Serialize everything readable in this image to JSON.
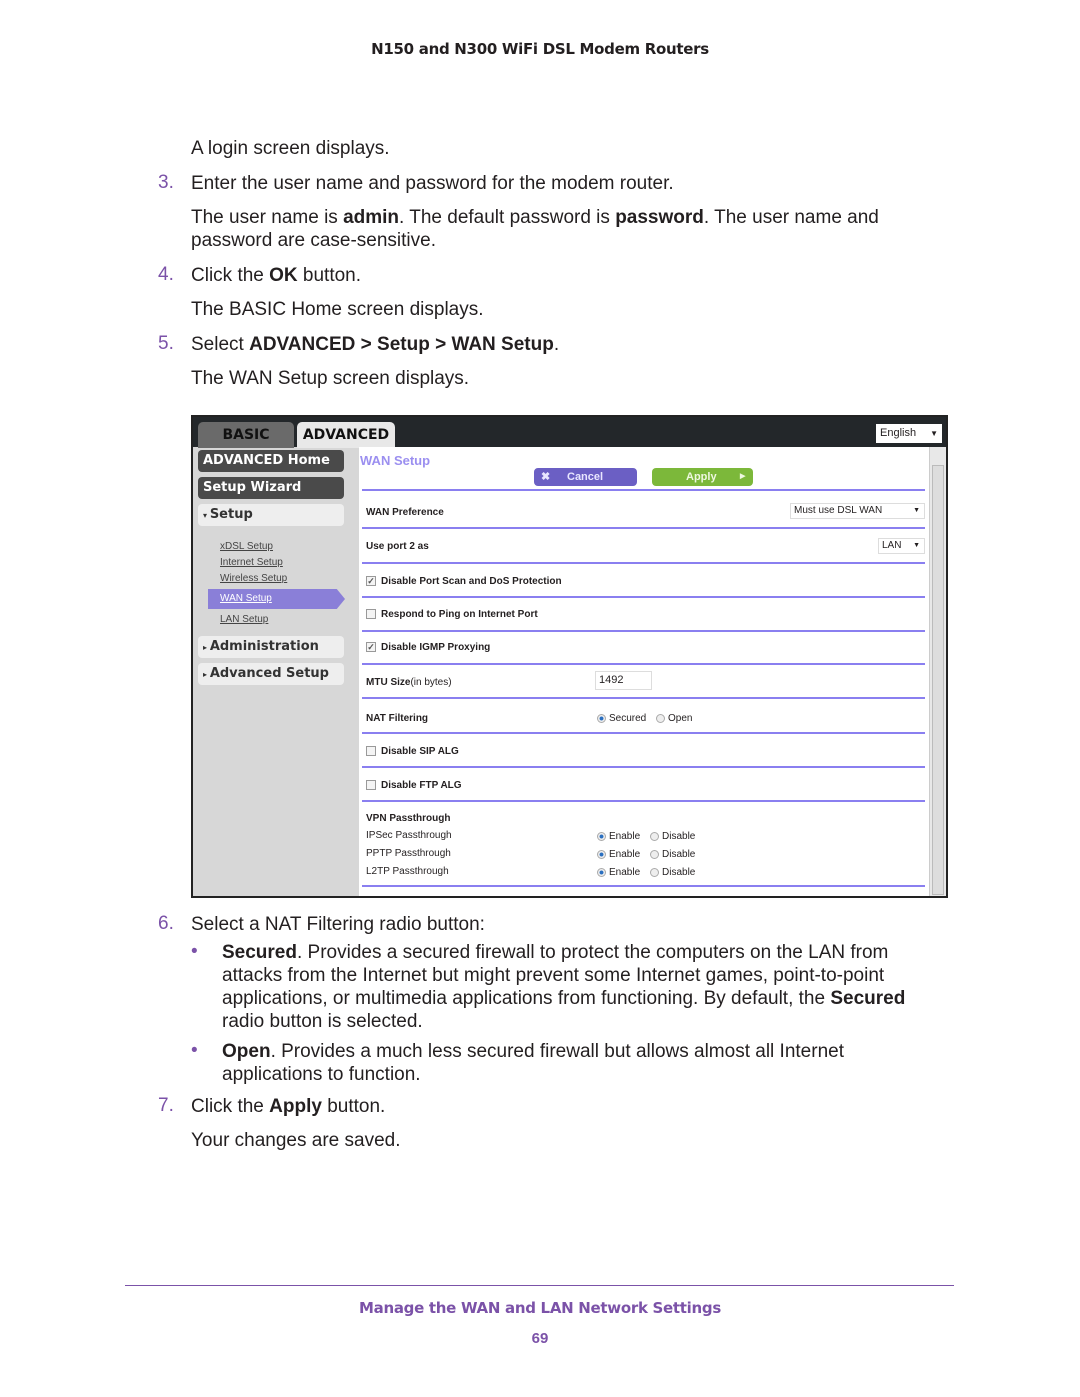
{
  "header": {
    "title": "N150 and N300 WiFi DSL Modem Routers"
  },
  "body": {
    "login_displays": "A login screen displays.",
    "step3": {
      "num": "3.",
      "text": "Enter the user name and password for the modem router."
    },
    "creds": {
      "a": "The user name is ",
      "user": "admin",
      "b": ". The default password is ",
      "pass": "password",
      "c": ". The user name and password are case-sensitive."
    },
    "step4": {
      "num": "4.",
      "a": "Click the ",
      "ok": "OK",
      "b": " button."
    },
    "basic_home": "The BASIC Home screen displays.",
    "step5": {
      "num": "5.",
      "a": "Select ",
      "adv": "ADVANCED",
      "sep1": " > ",
      "setup": "Setup",
      "sep2": " > ",
      "wan": "WAN Setup",
      "end": "."
    },
    "wan_displays": "The WAN Setup screen displays.",
    "step6": {
      "num": "6.",
      "text": "Select a NAT Filtering radio button:"
    },
    "bullet1": {
      "mark": "•",
      "term": "Secured",
      "a": ". Provides a secured firewall to protect the computers on the LAN from attacks from the Internet but might prevent some Internet games, point-to-point applications, or multimedia applications from functioning. By default, the ",
      "term2": "Secured",
      "b": " radio button is selected."
    },
    "bullet2": {
      "mark": "•",
      "term": "Open",
      "a": ". Provides a much less secured firewall but allows almost all Internet applications to function."
    },
    "step7": {
      "num": "7.",
      "a": "Click the ",
      "apply": "Apply",
      "b": " button."
    },
    "saved": "Your changes are saved."
  },
  "screenshot": {
    "tabs": [
      "BASIC",
      "ADVANCED"
    ],
    "language": "English",
    "sidebar": {
      "advanced_home": "ADVANCED Home",
      "setup_wizard": "Setup Wizard",
      "setup": "Setup",
      "sub": [
        "xDSL Setup",
        "Internet Setup",
        "Wireless Setup",
        "WAN Setup",
        "LAN Setup"
      ],
      "administration": "Administration",
      "advanced_setup": "Advanced Setup"
    },
    "title": "WAN Setup",
    "cancel": "Cancel",
    "apply": "Apply",
    "wan_pref_label": "WAN Preference",
    "wan_pref_value": "Must use DSL WAN",
    "port2_label": "Use port 2 as",
    "port2_value": "LAN",
    "disable_portscan": "Disable Port Scan and DoS Protection",
    "respond_ping": "Respond to Ping on Internet Port",
    "disable_igmp": "Disable IGMP Proxying",
    "mtu_label": "MTU Size",
    "mtu_unit": "(in bytes)",
    "mtu_value": "1492",
    "nat_label": "NAT Filtering",
    "secured": "Secured",
    "open": "Open",
    "disable_sip": "Disable SIP ALG",
    "disable_ftp": "Disable FTP ALG",
    "vpn": "VPN Passthrough",
    "vpn_rows": [
      "IPSec Passthrough",
      "PPTP Passthrough",
      "L2TP Passthrough"
    ],
    "enable": "Enable",
    "disable": "Disable",
    "colors": {
      "accent": "#8a7ff0",
      "apply": "#7cb83a",
      "cancel": "#6b5fc4"
    }
  },
  "footer": {
    "title": "Manage the WAN and LAN Network Settings",
    "page": "69"
  }
}
